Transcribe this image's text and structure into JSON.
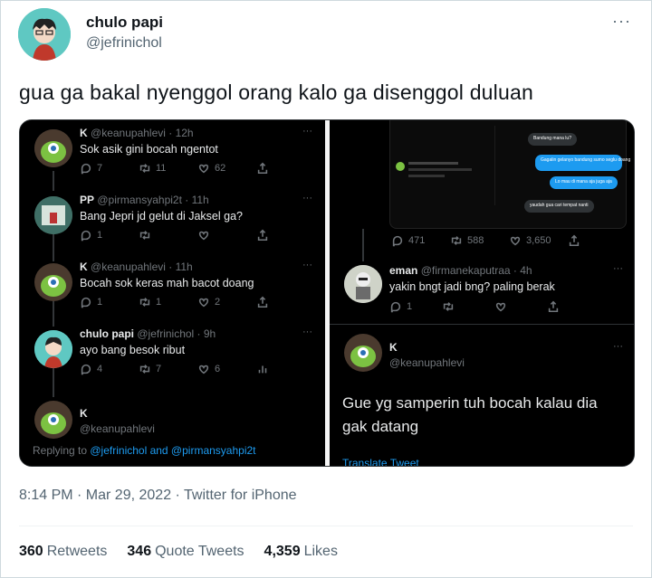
{
  "tweet": {
    "author_name": "chulo papi",
    "author_handle": "@jefrinichol",
    "more_label": "···",
    "text": "gua ga bakal nyenggol orang kalo ga disenggol duluan",
    "timestamp": "8:14 PM · Mar 29, 2022 · Twitter for iPhone",
    "stats": {
      "retweets_count": "360",
      "retweets_label": "Retweets",
      "quotes_count": "346",
      "quotes_label": "Quote Tweets",
      "likes_count": "4,359",
      "likes_label": "Likes"
    }
  },
  "media_left": {
    "replies": [
      {
        "name": "K",
        "handle": "@keanupahlevi · 12h",
        "text": "Sok asik gini bocah ngentot",
        "replies": "7",
        "retweets": "11",
        "likes": "62"
      },
      {
        "name": "PP",
        "handle": "@pirmansyahpi2t · 11h",
        "text": "Bang Jepri jd gelut di Jaksel ga?",
        "replies": "1",
        "retweets": "",
        "likes": ""
      },
      {
        "name": "K",
        "handle": "@keanupahlevi · 11h",
        "text": "Bocah sok keras mah bacot doang",
        "replies": "1",
        "retweets": "1",
        "likes": "2"
      },
      {
        "name": "chulo papi",
        "handle": "@jefrinichol · 9h",
        "text": "ayo bang besok ribut",
        "replies": "4",
        "retweets": "7",
        "likes": "6"
      }
    ],
    "last": {
      "name": "K",
      "handle": "@keanupahlevi"
    },
    "replying_prefix": "Replying to ",
    "replying_to": "@jefrinichol and @pirmansyahpi2t"
  },
  "media_right": {
    "dm_bubbles": [
      "Bandung mana lu?",
      "Gagalin gelanyo bandung sumo seglu doang",
      "Lo mau di mana aja juga aja",
      "yaudah gua cari tempat nanti"
    ],
    "top_stats": {
      "replies": "471",
      "retweets": "588",
      "likes": "3,650"
    },
    "reply_eman": {
      "name": "eman",
      "handle": "@firmanekaputraa · 4h",
      "text": "yakin bngt jadi bng? paling berak",
      "replies": "1"
    },
    "last": {
      "name": "K",
      "handle": "@keanupahlevi",
      "text_line1": "Gue yg samperin tuh bocah kalau dia",
      "text_line2": "gak datang"
    },
    "translate": "Translate Tweet"
  }
}
